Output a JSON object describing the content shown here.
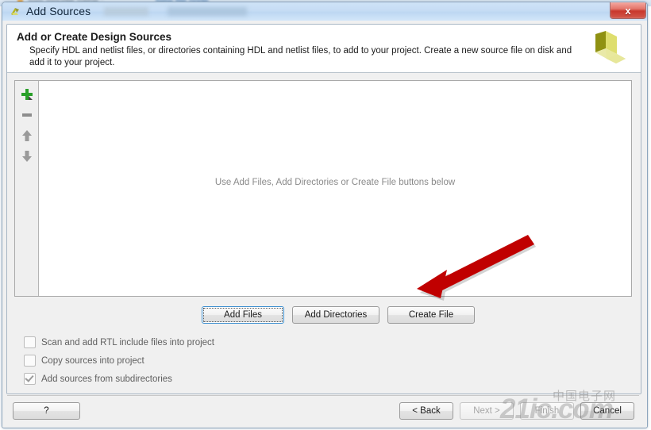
{
  "window": {
    "title": "Add Sources",
    "app_icon": "xilinx-vivado-icon",
    "close_label": "x"
  },
  "background_window": {
    "text_left": "Tom moudie naine :",
    "text_right": "New file node"
  },
  "header": {
    "title": "Add or Create Design Sources",
    "description": "Specify HDL and netlist files, or directories containing HDL and netlist files, to add to your project. Create a new source file on disk and add it to your project.",
    "logo": "xilinx-logo"
  },
  "list_toolbar": {
    "items": [
      {
        "name": "add-icon",
        "icon": "plus-green",
        "label": "Add"
      },
      {
        "name": "remove-icon",
        "icon": "minus-gray",
        "label": "Remove"
      },
      {
        "name": "move-up-icon",
        "icon": "arrow-up-gray",
        "label": "Move Up"
      },
      {
        "name": "move-down-icon",
        "icon": "arrow-down-gray",
        "label": "Move Down"
      }
    ]
  },
  "file_list": {
    "empty_message": "Use Add Files, Add Directories or Create File buttons below",
    "rows": []
  },
  "action_buttons": [
    {
      "name": "add-files-button",
      "label": "Add Files",
      "focused": true
    },
    {
      "name": "add-directories-button",
      "label": "Add Directories",
      "focused": false
    },
    {
      "name": "create-file-button",
      "label": "Create File",
      "focused": false
    }
  ],
  "options": [
    {
      "name": "scan-rtl-include-checkbox",
      "label": "Scan and add RTL include files into project",
      "checked": false
    },
    {
      "name": "copy-sources-checkbox",
      "label": "Copy sources into project",
      "checked": false
    },
    {
      "name": "add-subdirectories-checkbox",
      "label": "Add sources from subdirectories",
      "checked": true
    }
  ],
  "footer": {
    "help_label": "?",
    "buttons": [
      {
        "name": "back-button",
        "label": "< Back",
        "enabled": true
      },
      {
        "name": "next-button",
        "label": "Next >",
        "enabled": false
      },
      {
        "name": "finish-button",
        "label": "Finish",
        "enabled": false
      },
      {
        "name": "cancel-button",
        "label": "Cancel",
        "enabled": true
      }
    ]
  },
  "annotation": {
    "arrow": "red-arrow-pointing-to-create-file",
    "color": "#c00000"
  },
  "watermark": {
    "text": "21ic.com",
    "chinese": "中国电子网"
  },
  "colors": {
    "accent_green": "#2aa02a",
    "logo_olive": "#a5a81f",
    "title_bar": "#c5dcf4",
    "close_red": "#c8372c"
  }
}
